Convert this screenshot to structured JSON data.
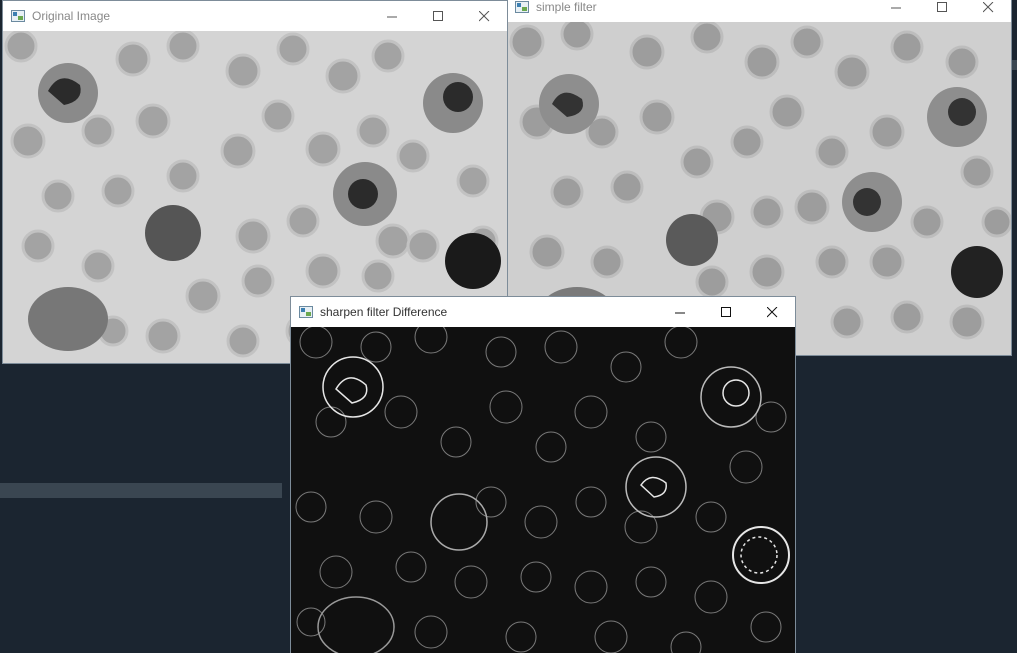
{
  "windows": {
    "original": {
      "title": "Original Image",
      "icon": "app-image-icon"
    },
    "simple": {
      "title": "simple filter",
      "icon": "app-image-icon"
    },
    "sharpen": {
      "title": "sharpen filter Difference",
      "icon": "app-image-icon"
    }
  },
  "controls": {
    "minimize": "minimize-icon",
    "maximize": "maximize-icon",
    "close": "close-icon"
  },
  "colors": {
    "desktop": "#1b2530",
    "title_bar": "#ffffff",
    "image_background": "#d2d2d2",
    "red_cell": "#9e9e9e",
    "difference_background": "#101010",
    "difference_edge": "#e6e6e6"
  }
}
